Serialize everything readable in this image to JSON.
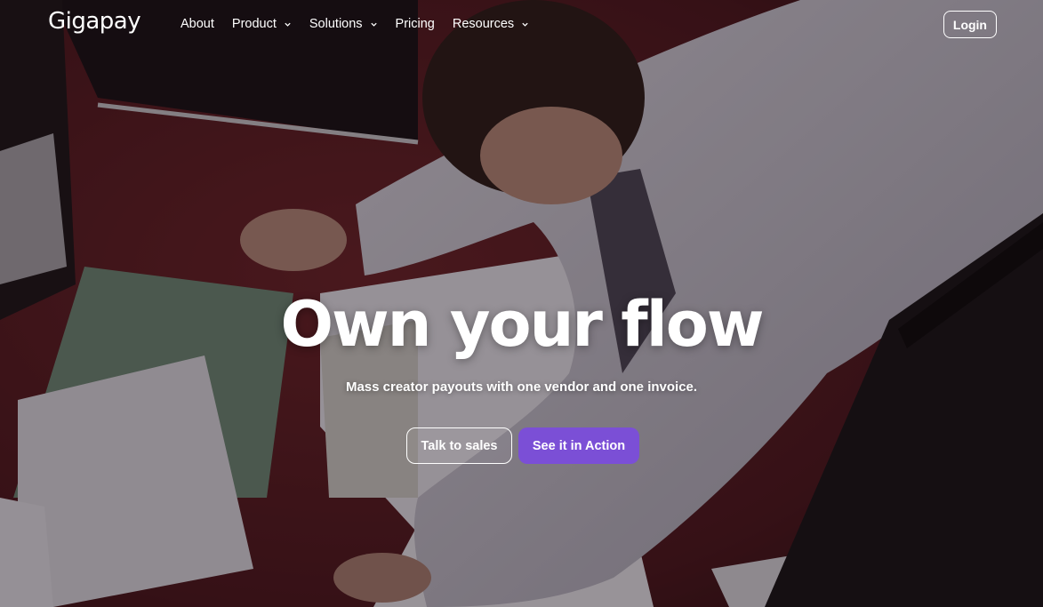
{
  "brand": {
    "logo_text": "Gigapay"
  },
  "nav": {
    "items": [
      {
        "label": "About",
        "has_dropdown": false
      },
      {
        "label": "Product",
        "has_dropdown": true
      },
      {
        "label": "Solutions",
        "has_dropdown": true
      },
      {
        "label": "Pricing",
        "has_dropdown": false
      },
      {
        "label": "Resources",
        "has_dropdown": true
      }
    ],
    "login_label": "Login"
  },
  "hero": {
    "headline": "Own your flow",
    "subtitle": "Mass creator payouts with one vendor and one invoice.",
    "cta_secondary": "Talk to sales",
    "cta_primary": "See it in Action"
  },
  "colors": {
    "primary_button": "#7b4fd6",
    "text": "#ffffff",
    "background_carpet": "#5a1f24"
  },
  "icons": {
    "dropdown": "chevron-down-icon"
  }
}
